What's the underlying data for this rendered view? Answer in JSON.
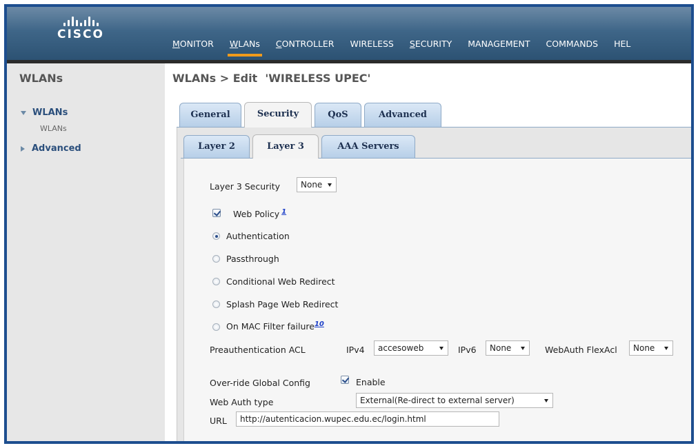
{
  "brand": {
    "logo": "cisco",
    "name": "CISCO"
  },
  "nav": [
    "MONITOR",
    "WLANs",
    "CONTROLLER",
    "WIRELESS",
    "SECURITY",
    "MANAGEMENT",
    "COMMANDS",
    "HEL"
  ],
  "sidebar": {
    "title": "WLANs",
    "items": [
      {
        "label": "WLANs",
        "expanded": true,
        "children": [
          "WLANs"
        ]
      },
      {
        "label": "Advanced",
        "expanded": false
      }
    ]
  },
  "page": {
    "title": "WLANs > Edit  'WIRELESS UPEC'"
  },
  "tabs": [
    "General",
    "Security",
    "QoS",
    "Advanced"
  ],
  "subtabs": [
    "Layer 2",
    "Layer 3",
    "AAA Servers"
  ],
  "form": {
    "layer3_security": {
      "label": "Layer 3 Security",
      "value": "None"
    },
    "web_policy": {
      "label": "Web Policy",
      "footnote": "1",
      "checked": true
    },
    "radios": [
      {
        "label": "Authentication",
        "footnote": "",
        "selected": true
      },
      {
        "label": "Passthrough",
        "footnote": "",
        "selected": false
      },
      {
        "label": "Conditional Web Redirect",
        "footnote": "",
        "selected": false
      },
      {
        "label": "Splash Page Web Redirect",
        "footnote": "",
        "selected": false
      },
      {
        "label": "On MAC Filter failure",
        "footnote": "10",
        "selected": false
      }
    ],
    "preauth": {
      "label": "Preauthentication ACL",
      "ipv4_label": "IPv4",
      "ipv4_value": "accesoweb",
      "ipv6_label": "IPv6",
      "ipv6_value": "None",
      "flex_label": "WebAuth FlexAcl",
      "flex_value": "None"
    },
    "override": {
      "label": "Over-ride Global Config",
      "checkbox_label": "Enable",
      "checked": true
    },
    "web_auth_type": {
      "label": "Web Auth type",
      "value": "External(Re-direct to external server)"
    },
    "url": {
      "label": "URL",
      "value": "http://autenticacion.wupec.edu.ec/login.html"
    }
  },
  "colors": {
    "header": "#3f6688",
    "active_nav": "#f09a1c",
    "sidebar": "#e7e7e7",
    "border": "#1d4e8f"
  }
}
